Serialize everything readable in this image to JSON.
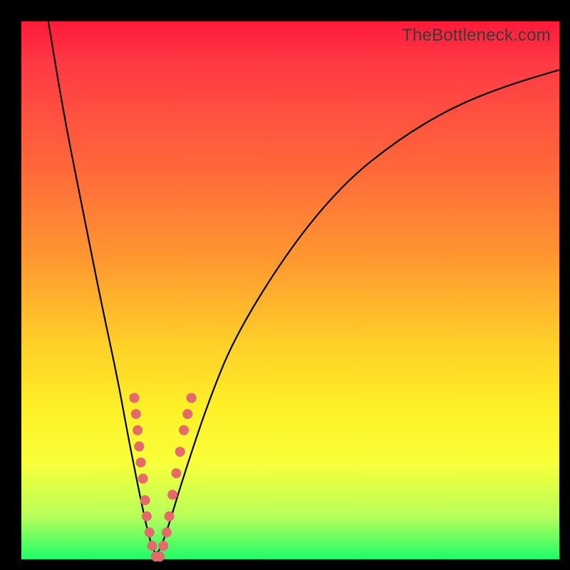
{
  "watermark": "TheBottleneck.com",
  "colors": {
    "frame": "#000000",
    "gradient_top": "#ff1a3a",
    "gradient_mid_upper": "#ff9a30",
    "gradient_mid_lower": "#fff028",
    "gradient_bottom": "#1efc6a",
    "curve": "#000000",
    "marker": "#e66a6a"
  },
  "chart_data": {
    "type": "line",
    "title": "",
    "xlabel": "",
    "ylabel": "",
    "xlim": [
      0,
      100
    ],
    "ylim": [
      0,
      100
    ],
    "grid": false,
    "legend": false,
    "series": [
      {
        "name": "bottleneck-curve",
        "x": [
          5,
          8,
          12,
          15,
          18,
          20,
          22,
          23.5,
          25,
          27,
          30,
          35,
          40,
          50,
          60,
          70,
          80,
          90,
          100
        ],
        "y": [
          100,
          82,
          62,
          47,
          33,
          22,
          12,
          5,
          0,
          5,
          15,
          30,
          42,
          58,
          70,
          78,
          84,
          88,
          91
        ]
      }
    ],
    "markers": [
      {
        "x": 21.0,
        "y": 30
      },
      {
        "x": 21.3,
        "y": 27
      },
      {
        "x": 21.6,
        "y": 24
      },
      {
        "x": 21.9,
        "y": 21
      },
      {
        "x": 22.2,
        "y": 18
      },
      {
        "x": 22.6,
        "y": 15
      },
      {
        "x": 23.0,
        "y": 11
      },
      {
        "x": 23.3,
        "y": 8
      },
      {
        "x": 23.8,
        "y": 5
      },
      {
        "x": 24.3,
        "y": 2.5
      },
      {
        "x": 25.0,
        "y": 0.5
      },
      {
        "x": 25.7,
        "y": 0.5
      },
      {
        "x": 26.4,
        "y": 2.5
      },
      {
        "x": 27.0,
        "y": 5
      },
      {
        "x": 27.5,
        "y": 8
      },
      {
        "x": 28.1,
        "y": 12
      },
      {
        "x": 28.8,
        "y": 16
      },
      {
        "x": 29.5,
        "y": 20
      },
      {
        "x": 30.2,
        "y": 24
      },
      {
        "x": 30.9,
        "y": 27
      },
      {
        "x": 31.6,
        "y": 30
      }
    ]
  }
}
